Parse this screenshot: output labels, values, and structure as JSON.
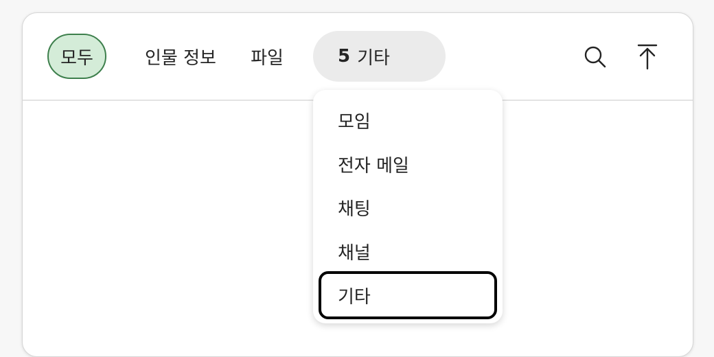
{
  "tabs": {
    "all": "모두",
    "people": "인물 정보",
    "files": "파일",
    "more_count": "5",
    "more_label": "기타"
  },
  "dropdown": {
    "items": [
      {
        "label": "모임"
      },
      {
        "label": "전자 메일"
      },
      {
        "label": "채팅"
      },
      {
        "label": "채널"
      },
      {
        "label": "기타"
      }
    ],
    "focused_index": 4
  },
  "icons": {
    "search": "search-icon",
    "scroll_top": "arrow-up-to-top-icon"
  },
  "colors": {
    "selected_tab_bg": "#d4ecd8",
    "selected_tab_border": "#3d7f4c",
    "more_tab_bg": "#ebebeb",
    "focus_ring": "#000000"
  }
}
